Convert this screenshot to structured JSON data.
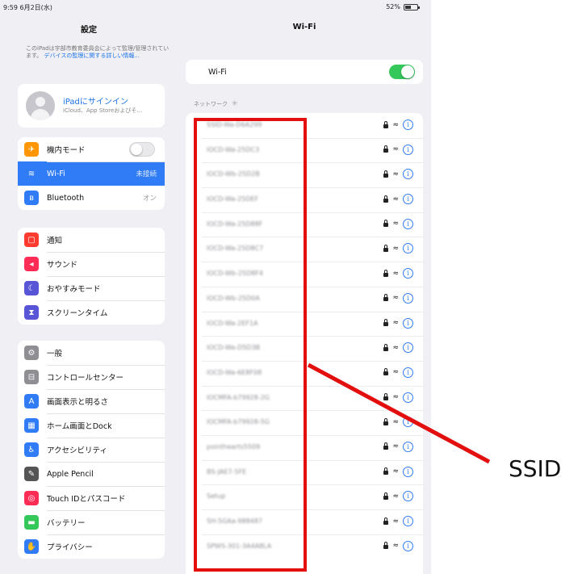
{
  "status_bar": {
    "time_date": "9:59  6月2日(水)",
    "battery": "52%",
    "battery_level": 0.52
  },
  "sidebar": {
    "title": "設定",
    "notice": {
      "text": "このiPadは宇部市教育委員会によって監理/管理されています。",
      "link": "デバイスの監理に関する詳しい情報..."
    },
    "account": {
      "title": "iPadにサインイン",
      "subtitle": "iCloud、App Storeおよびそ…"
    },
    "group1": [
      {
        "label": "機内モード",
        "icon": "airplane-icon",
        "color": "#ff9500",
        "toggle": "off"
      },
      {
        "label": "Wi-Fi",
        "icon": "wifi-icon",
        "color": "#2f7cf6",
        "value": "未接続",
        "active": true
      },
      {
        "label": "Bluetooth",
        "icon": "bluetooth-icon",
        "color": "#2f7cf6",
        "value": "オン"
      }
    ],
    "group2": [
      {
        "label": "通知",
        "icon": "notifications-icon",
        "color": "#ff3b30"
      },
      {
        "label": "サウンド",
        "icon": "sound-icon",
        "color": "#ff2d55"
      },
      {
        "label": "おやすみモード",
        "icon": "moon-icon",
        "color": "#5856d6"
      },
      {
        "label": "スクリーンタイム",
        "icon": "hourglass-icon",
        "color": "#5856d6"
      }
    ],
    "group3": [
      {
        "label": "一般",
        "icon": "gear-icon",
        "color": "#8e8e93"
      },
      {
        "label": "コントロールセンター",
        "icon": "control-center-icon",
        "color": "#8e8e93"
      },
      {
        "label": "画面表示と明るさ",
        "icon": "display-icon",
        "color": "#2f7cf6"
      },
      {
        "label": "ホーム画面とDock",
        "icon": "home-screen-icon",
        "color": "#2f7cf6"
      },
      {
        "label": "アクセシビリティ",
        "icon": "accessibility-icon",
        "color": "#2f7cf6"
      },
      {
        "label": "Apple Pencil",
        "icon": "pencil-icon",
        "color": "#555555"
      },
      {
        "label": "Touch IDとパスコード",
        "icon": "fingerprint-icon",
        "color": "#ff2d55"
      },
      {
        "label": "バッテリー",
        "icon": "battery-icon",
        "color": "#34c759"
      },
      {
        "label": "プライバシー",
        "icon": "hand-icon",
        "color": "#2f7cf6"
      }
    ]
  },
  "detail": {
    "title": "Wi-Fi",
    "wifi_label": "Wi-Fi",
    "wifi_toggle": "on",
    "networks_header": "ネットワーク",
    "networks": [
      "SSID-Wa-D6A299",
      "IOCD-Wa-25DC3",
      "IOCD-Wb-25D2B",
      "IOCD-Wa-25DEF",
      "IOCD-Wa-25D88F",
      "IOCD-Wa-25D8C7",
      "IOCD-Wb-25D8F4",
      "IOCD-Wb-25D0A",
      "IOCD-Wa-2EF1A",
      "IOCD-Wa-D5D3B",
      "IOCD-Wa-6E8F08",
      "IOCMFA-b79928-2G",
      "IOCMFA-b79928-5G",
      "pointhearts5509",
      "BS-JAE7-5FE",
      "Setup",
      "SH-5GAa-988487",
      "SPWS-301-3A4A8LA"
    ]
  },
  "annotation": {
    "label": "SSID",
    "color": "#e30e0e"
  }
}
